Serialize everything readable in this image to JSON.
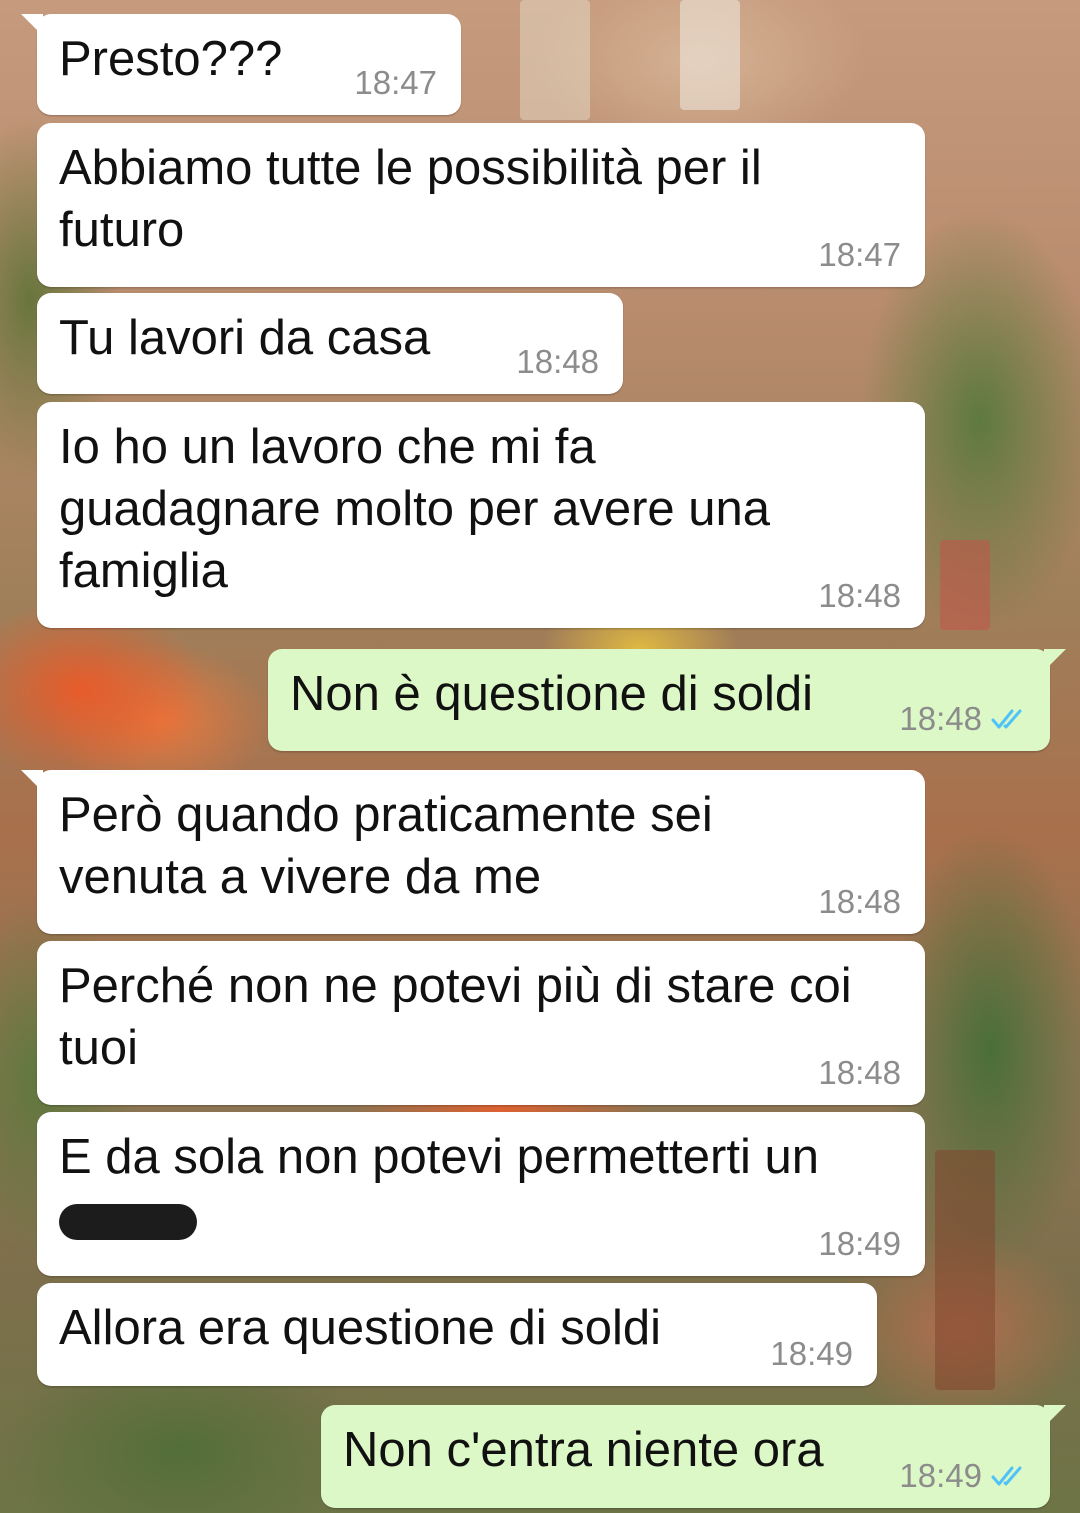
{
  "chat": {
    "messages": [
      {
        "direction": "incoming",
        "lines": [
          "Presto???"
        ],
        "time": "18:47"
      },
      {
        "direction": "incoming",
        "lines": [
          "Abbiamo tutte le possibilità per il",
          "futuro"
        ],
        "time": "18:47"
      },
      {
        "direction": "incoming",
        "lines": [
          "Tu lavori da casa"
        ],
        "time": "18:48"
      },
      {
        "direction": "incoming",
        "lines": [
          "Io ho un lavoro che mi fa",
          "guadagnare molto per avere una",
          "famiglia"
        ],
        "time": "18:48"
      },
      {
        "direction": "outgoing",
        "lines": [
          "Non è questione di soldi"
        ],
        "time": "18:48",
        "status": "read"
      },
      {
        "direction": "incoming",
        "lines": [
          "Però quando praticamente sei",
          "venuta a vivere da me"
        ],
        "time": "18:48"
      },
      {
        "direction": "incoming",
        "lines": [
          "Perché non ne potevi più di stare coi",
          "tuoi"
        ],
        "time": "18:48"
      },
      {
        "direction": "incoming",
        "lines": [
          "E da sola non potevi permetterti un"
        ],
        "time": "18:49",
        "redacted_word": true
      },
      {
        "direction": "incoming",
        "lines": [
          "Allora era questione di soldi"
        ],
        "time": "18:49"
      },
      {
        "direction": "outgoing",
        "lines": [
          "Non c'entra niente ora"
        ],
        "time": "18:49",
        "status": "read"
      }
    ]
  },
  "colors": {
    "incoming_bubble": "#ffffff",
    "outgoing_bubble": "#dcf8c6",
    "timestamp": "#8c8c8c",
    "read_ticks": "#4fc3f7",
    "redaction": "#1c1c1c"
  },
  "icons": {
    "read_receipt": "double-check-icon"
  }
}
